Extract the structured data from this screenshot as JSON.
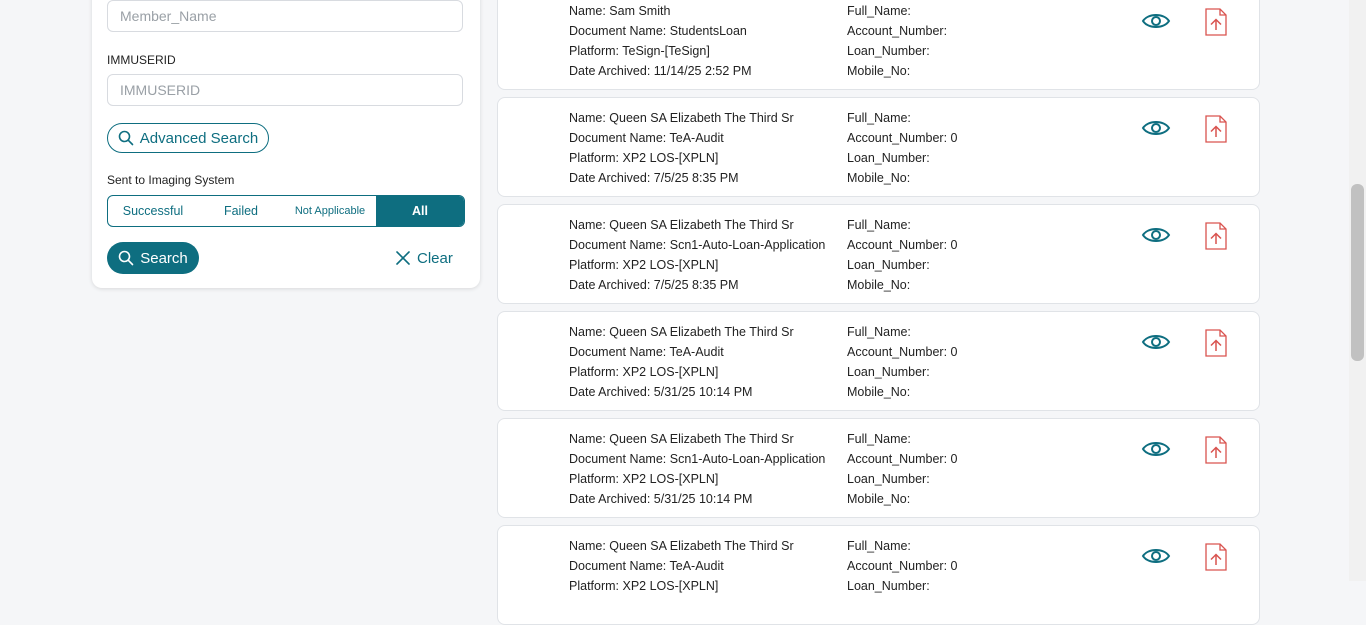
{
  "filters": {
    "member_name_placeholder": "Member_Name",
    "immuserid_label": "IMMUSERID",
    "immuserid_placeholder": "IMMUSERID",
    "advanced_search_label": "Advanced Search",
    "sent_to_imaging_label": "Sent to Imaging System",
    "segments": [
      "Successful",
      "Failed",
      "Not Applicable",
      "All"
    ],
    "selected_segment": "All",
    "search_label": "Search",
    "clear_label": "Clear"
  },
  "results": [
    {
      "name": "Name: Sam Smith",
      "document": "Document Name: StudentsLoan",
      "platform": "Platform: TeSign-[TeSign]",
      "date": "Date Archived: 11/14/25 2:52 PM",
      "full_name": "Full_Name:",
      "account": "Account_Number:",
      "loan": "Loan_Number:",
      "mobile": "Mobile_No:"
    },
    {
      "name": "Name: Queen SA Elizabeth The Third Sr",
      "document": "Document Name: TeA-Audit",
      "platform": "Platform: XP2 LOS-[XPLN]",
      "date": "Date Archived: 7/5/25 8:35 PM",
      "full_name": "Full_Name:",
      "account": "Account_Number: 0",
      "loan": "Loan_Number:",
      "mobile": "Mobile_No:"
    },
    {
      "name": "Name: Queen SA Elizabeth The Third Sr",
      "document": "Document Name: Scn1-Auto-Loan-Application",
      "platform": "Platform: XP2 LOS-[XPLN]",
      "date": "Date Archived: 7/5/25 8:35 PM",
      "full_name": "Full_Name:",
      "account": "Account_Number: 0",
      "loan": "Loan_Number:",
      "mobile": "Mobile_No:"
    },
    {
      "name": "Name: Queen SA Elizabeth The Third Sr",
      "document": "Document Name: TeA-Audit",
      "platform": "Platform: XP2 LOS-[XPLN]",
      "date": "Date Archived: 5/31/25 10:14 PM",
      "full_name": "Full_Name:",
      "account": "Account_Number: 0",
      "loan": "Loan_Number:",
      "mobile": "Mobile_No:"
    },
    {
      "name": "Name: Queen SA Elizabeth The Third Sr",
      "document": "Document Name: Scn1-Auto-Loan-Application",
      "platform": "Platform: XP2 LOS-[XPLN]",
      "date": "Date Archived: 5/31/25 10:14 PM",
      "full_name": "Full_Name:",
      "account": "Account_Number: 0",
      "loan": "Loan_Number:",
      "mobile": "Mobile_No:"
    },
    {
      "name": "Name: Queen SA Elizabeth The Third Sr",
      "document": "Document Name: TeA-Audit",
      "platform": "Platform: XP2 LOS-[XPLN]",
      "date": "",
      "full_name": "Full_Name:",
      "account": "Account_Number: 0",
      "loan": "Loan_Number:",
      "mobile": ""
    }
  ],
  "icons": {
    "view": "eye-icon",
    "pdf": "pdf-upload-icon",
    "search": "search-icon",
    "clear": "close-icon"
  },
  "colors": {
    "accent": "#0e6e80",
    "pdf_red": "#d9534f"
  }
}
